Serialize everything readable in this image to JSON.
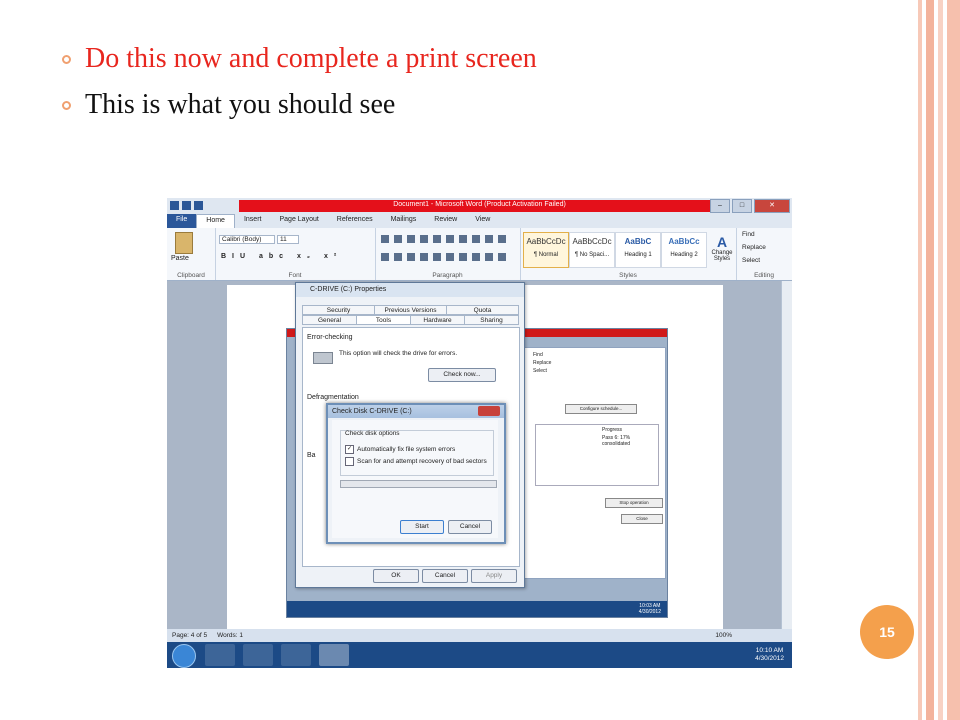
{
  "slide": {
    "bullets": [
      "Do this now and complete a print screen",
      "This is what you should see"
    ],
    "page_number": "15"
  },
  "word": {
    "title": "Document1 - Microsoft Word (Product Activation Failed)",
    "tabs": [
      "File",
      "Home",
      "Insert",
      "Page Layout",
      "References",
      "Mailings",
      "Review",
      "View"
    ],
    "font_name": "Calibri (Body)",
    "font_size": "11",
    "group_labels": [
      "Clipboard",
      "Font",
      "Paragraph",
      "Styles",
      "Editing"
    ],
    "paste_label": "Paste",
    "styles": [
      {
        "preview": "AaBbCcDc",
        "name": "¶ Normal"
      },
      {
        "preview": "AaBbCcDc",
        "name": "¶ No Spaci..."
      },
      {
        "preview": "AaBbC",
        "name": "Heading 1"
      },
      {
        "preview": "AaBbCc",
        "name": "Heading 2"
      }
    ],
    "change_styles": "Change Styles",
    "editing": [
      "Find",
      "Replace",
      "Select"
    ],
    "status": {
      "page": "Page: 4 of 5",
      "words": "Words: 1",
      "zoom": "100%"
    },
    "clock": {
      "time": "10:10 AM",
      "date": "4/30/2012"
    }
  },
  "properties_dialog": {
    "title": "C-DRIVE (C:) Properties",
    "tabs_row1": [
      "Security",
      "Previous Versions",
      "Quota"
    ],
    "tabs_row2": [
      "General",
      "Tools",
      "Hardware",
      "Sharing"
    ],
    "error_checking": "Error-checking",
    "error_text": "This option will check the drive for errors.",
    "check_now": "Check now...",
    "defrag": "Defragmentation",
    "backup": "Ba",
    "buttons": [
      "OK",
      "Cancel",
      "Apply"
    ]
  },
  "check_disk": {
    "title": "Check Disk C-DRIVE (C:)",
    "options_title": "Check disk options",
    "opt1": "Automatically fix file system errors",
    "opt2": "Scan for and attempt recovery of bad sectors",
    "start": "Start",
    "cancel": "Cancel"
  },
  "inner": {
    "find": "Find",
    "replace": "Replace",
    "select": "Select",
    "configure": "Configure schedule...",
    "progress_header": "Progress",
    "progress_value": "Pass 6: 17% consolidated",
    "stop": "Stop operation",
    "close": "Close",
    "clock_time": "10:03 AM",
    "clock_date": "4/30/2012"
  }
}
